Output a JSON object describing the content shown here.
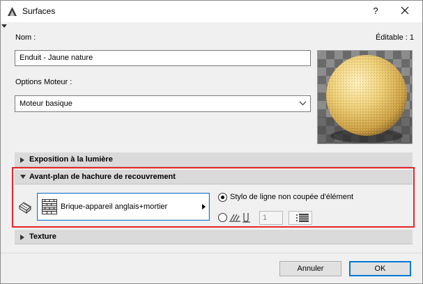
{
  "window": {
    "title": "Surfaces",
    "help_label": "?"
  },
  "form": {
    "name_label": "Nom :",
    "editable_label": "Éditable : 1",
    "name_value": "Enduit - Jaune nature",
    "engine_options_label": "Options Moteur :",
    "engine_value": "Moteur basique"
  },
  "panels": {
    "exposure_title": "Exposition à la lumière",
    "overlay_title": "Avant-plan de hachure de recouvrement",
    "texture_title": "Texture"
  },
  "overlay": {
    "fill_name": "Brique-appareil anglais+mortier",
    "option_element_pen": "Stylo de ligne non coupée d'élément",
    "pen_value": "1",
    "selected_option": "element-pen"
  },
  "buttons": {
    "cancel": "Annuler",
    "ok": "OK"
  },
  "colors": {
    "highlight": "#e8232a",
    "focus": "#0078d7",
    "sphere": "#e6c86e"
  },
  "icons": [
    "app-icon",
    "close-icon",
    "chevron-down-icon",
    "triangle-right-icon",
    "triangle-down-icon",
    "fill-pattern-icon",
    "pen-icon"
  ]
}
